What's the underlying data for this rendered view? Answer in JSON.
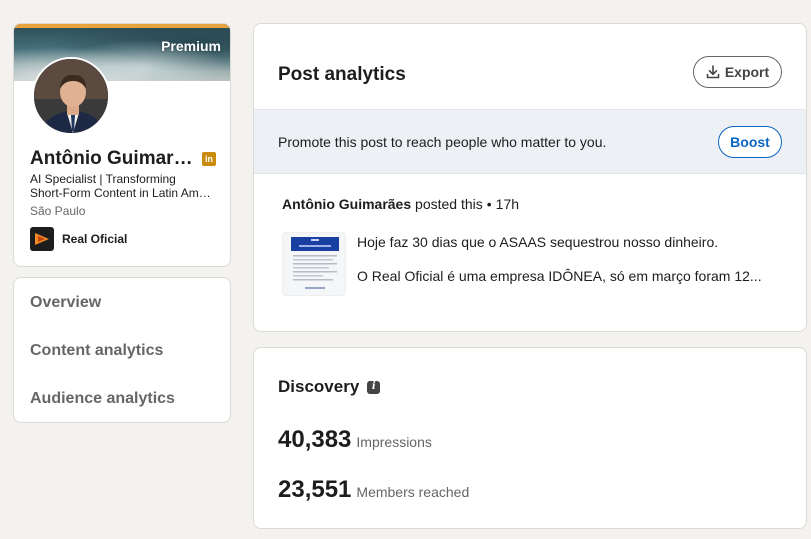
{
  "profile": {
    "banner_label": "Premium",
    "name": "Antônio Guimarães",
    "badge": "in",
    "headline_line1": "AI Specialist | Transforming",
    "headline_line2": "Short-Form Content in Latin America",
    "location": "São Paulo",
    "company": "Real Oficial",
    "colors": {
      "premium_accent": "#e7a33e",
      "badge": "#c98a0e"
    }
  },
  "nav": {
    "items": [
      {
        "label": "Overview"
      },
      {
        "label": "Content analytics"
      },
      {
        "label": "Audience analytics"
      }
    ]
  },
  "post_analytics": {
    "title": "Post analytics",
    "export_label": "Export",
    "promote_text": "Promote this post to reach people who matter to you.",
    "boost_label": "Boost",
    "post": {
      "author": "Antônio Guimarães",
      "action": "posted this",
      "time": "17h",
      "line1": "Hoje faz 30 dias que o ASAAS sequestrou nosso dinheiro.",
      "line2": "O Real Oficial é uma empresa IDÔNEA, só em março foram 12..."
    }
  },
  "discovery": {
    "title": "Discovery",
    "metrics": [
      {
        "value": "40,383",
        "label": "Impressions"
      },
      {
        "value": "23,551",
        "label": "Members reached"
      }
    ]
  },
  "colors": {
    "accent": "#0a66c2",
    "page_bg": "#f4f2ee"
  }
}
